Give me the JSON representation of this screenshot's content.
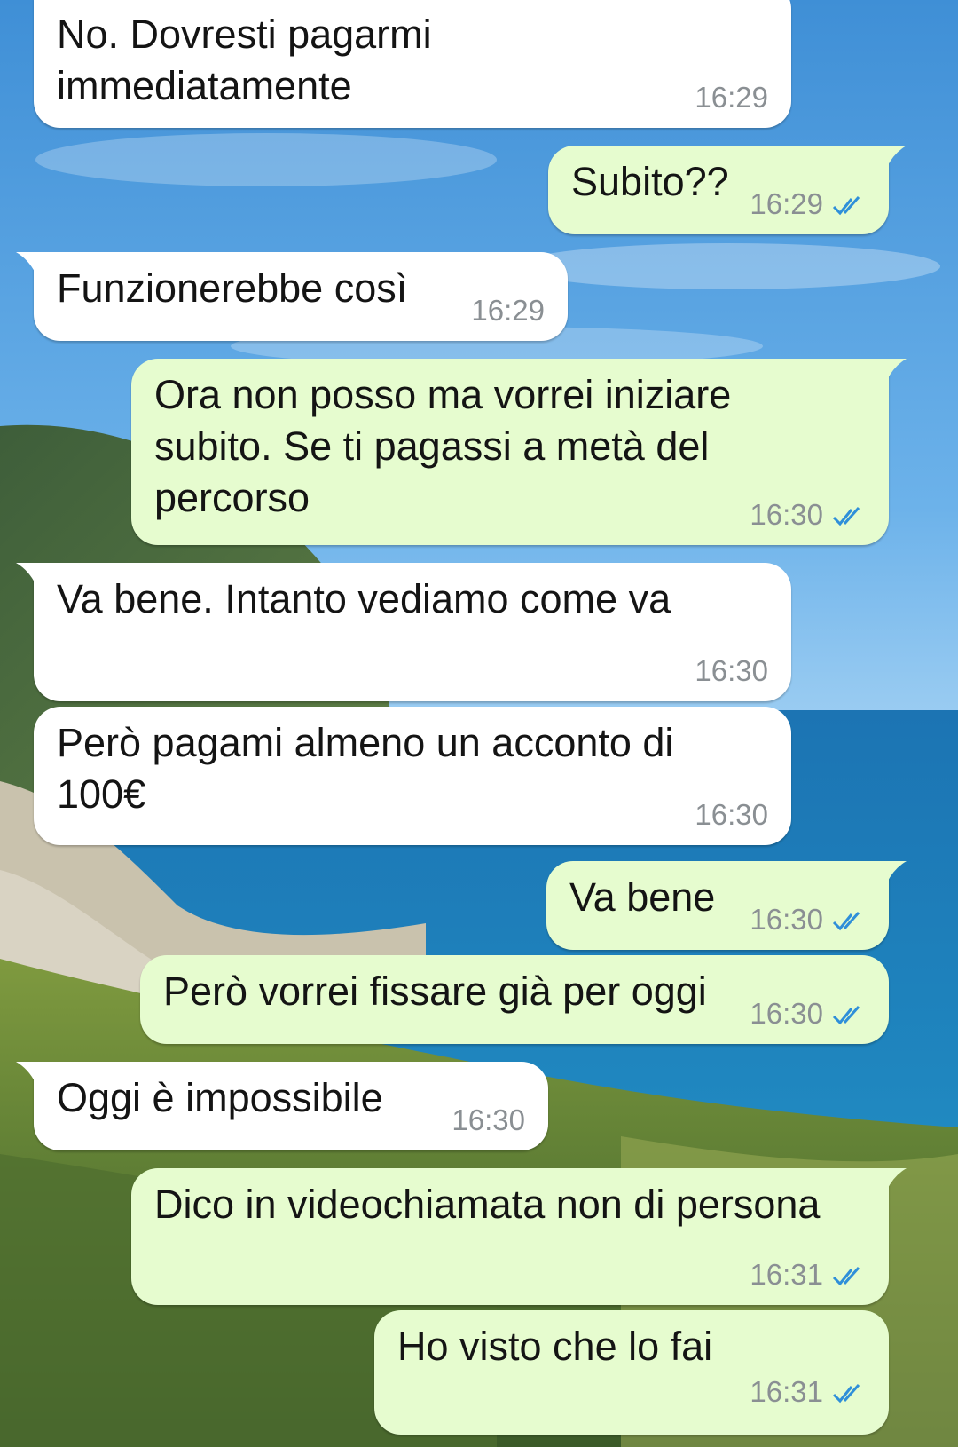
{
  "colors": {
    "incoming_bubble": "#ffffff",
    "outgoing_bubble": "#e6fccf",
    "timestamp": "#8a8f93",
    "read_ticks": "#2f8fd9"
  },
  "background": {
    "description_icon": "landscape-wallpaper"
  },
  "messages": [
    {
      "id": "m1",
      "direction": "in",
      "text": "No. Dovresti pagarmi\nimmediatamente",
      "time": "16:29",
      "status": ""
    },
    {
      "id": "m2",
      "direction": "out",
      "text": "Subito??",
      "time": "16:29",
      "status": "read"
    },
    {
      "id": "m3",
      "direction": "in",
      "text": "Funzionerebbe così",
      "time": "16:29",
      "status": ""
    },
    {
      "id": "m4",
      "direction": "out",
      "text": "Ora non posso ma vorrei iniziare\nsubito. Se ti pagassi a metà del\npercorso",
      "time": "16:30",
      "status": "read"
    },
    {
      "id": "m5",
      "direction": "in",
      "text": "Va bene. Intanto vediamo come va",
      "time": "16:30",
      "status": ""
    },
    {
      "id": "m6",
      "direction": "in",
      "text": "Però pagami almeno un acconto di\n100€",
      "time": "16:30",
      "status": ""
    },
    {
      "id": "m7",
      "direction": "out",
      "text": "Va bene",
      "time": "16:30",
      "status": "read"
    },
    {
      "id": "m8",
      "direction": "out",
      "text": "Però vorrei fissare già per oggi",
      "time": "16:30",
      "status": "read"
    },
    {
      "id": "m9",
      "direction": "in",
      "text": "Oggi è impossibile",
      "time": "16:30",
      "status": ""
    },
    {
      "id": "m10",
      "direction": "out",
      "text": "Dico in videochiamata non di persona",
      "time": "16:31",
      "status": "read"
    },
    {
      "id": "m11",
      "direction": "out",
      "text": "Ho visto che lo fai",
      "time": "16:31",
      "status": "read"
    }
  ]
}
